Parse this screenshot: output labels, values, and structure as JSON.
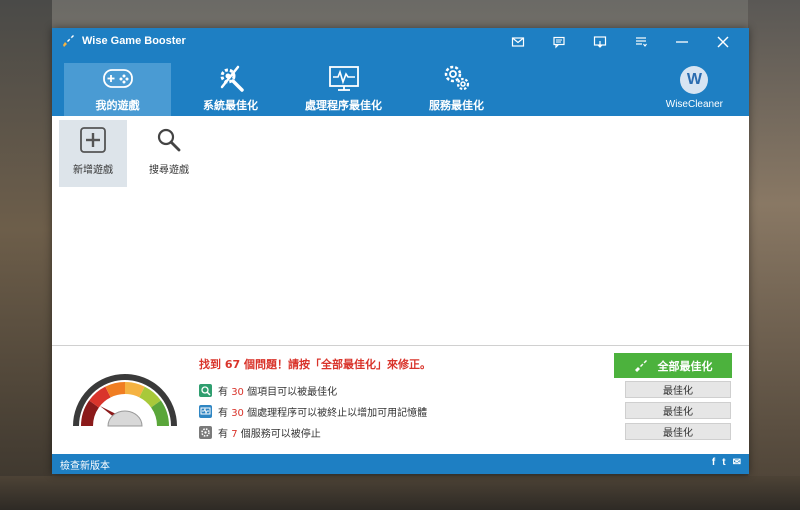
{
  "window": {
    "title": "Wise Game Booster"
  },
  "nav": {
    "tabs": [
      {
        "label": "我的遊戲",
        "icon": "gamepad-icon",
        "active": true
      },
      {
        "label": "系統最佳化",
        "icon": "tools-icon",
        "active": false
      },
      {
        "label": "處理程序最佳化",
        "icon": "monitor-pulse-icon",
        "active": false
      },
      {
        "label": "服務最佳化",
        "icon": "gears-icon",
        "active": false
      }
    ]
  },
  "brand": {
    "logo_letter": "W",
    "name": "WiseCleaner"
  },
  "games": {
    "add_label": "新增遊戲",
    "search_label": "搜尋遊戲"
  },
  "bottom": {
    "issue_message": "找到 67 個問題！請按「全部最佳化」來修正。",
    "issues": [
      {
        "prefix": "有 ",
        "count": "30",
        "suffix": " 個項目可以被最佳化",
        "icon": "system-icon"
      },
      {
        "prefix": "有 ",
        "count": "30",
        "suffix": " 個處理程序可以被終止以增加可用記憶體",
        "icon": "process-icon"
      },
      {
        "prefix": "有 ",
        "count": "7",
        "suffix": " 個服務可以被停止",
        "icon": "service-icon"
      }
    ],
    "optimize_all_label": "全部最佳化",
    "optimize_label": "最佳化"
  },
  "status": {
    "check_update": "檢查新版本"
  },
  "social": {
    "facebook": "f",
    "twitter": "t",
    "email": "✉"
  },
  "colors": {
    "header": "#1e7fc3",
    "active_tab": "#4a9bd3",
    "green": "#4cb23d",
    "alert": "#d9342b"
  }
}
